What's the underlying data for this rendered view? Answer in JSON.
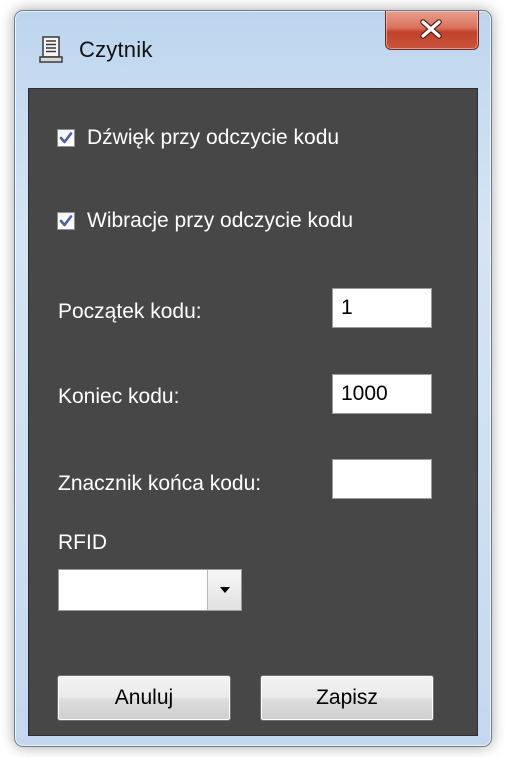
{
  "window": {
    "title": "Czytnik",
    "icon": "reader-device-icon",
    "close_icon": "close-icon"
  },
  "form": {
    "sound_checkbox": {
      "label": "Dźwięk przy odczycie kodu",
      "checked": true
    },
    "vibration_checkbox": {
      "label": "Wibracje przy odczycie kodu",
      "checked": true
    },
    "code_start": {
      "label": "Początek kodu:",
      "value": "1"
    },
    "code_end": {
      "label": "Koniec kodu:",
      "value": "1000"
    },
    "code_end_marker": {
      "label": "Znacznik końca kodu:",
      "value": ""
    },
    "rfid": {
      "label": "RFID",
      "selected": ""
    }
  },
  "buttons": {
    "cancel_label": "Anuluj",
    "save_label": "Zapisz"
  },
  "colors": {
    "client_background": "#474747",
    "close_button": "#c7503a"
  }
}
